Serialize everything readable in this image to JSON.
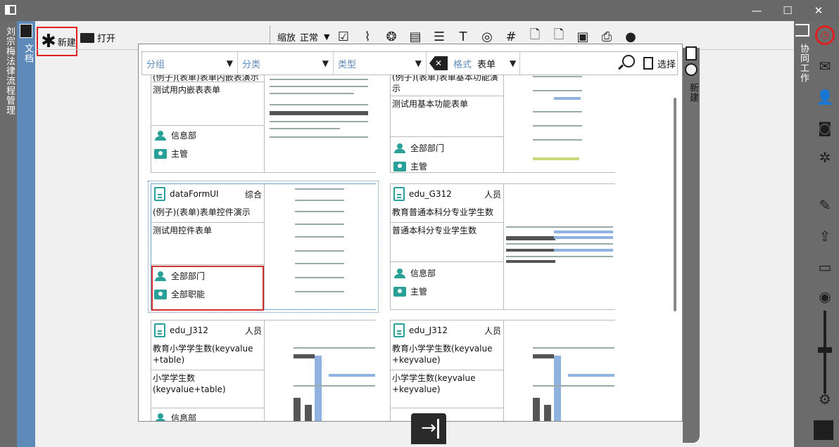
{
  "window": {
    "minimize": "—",
    "maximize": "☐",
    "close": "✕"
  },
  "left_strip": {
    "text": "刘宗梅法律流程管理"
  },
  "doc_strip": {
    "text": "文档"
  },
  "toolbar": {
    "new_label": "新建",
    "open_label": "打开",
    "zoom_label": "缩放",
    "zoom_value": "正常"
  },
  "new_strip": {
    "text": "新建"
  },
  "collab_strip": {
    "text": "协同工作"
  },
  "filter": {
    "group": "分组",
    "category": "分类",
    "type": "类型",
    "format_label": "格式",
    "format_value": "表单",
    "select": "选择"
  },
  "cards": [
    {
      "title": "(例子)(表单)表单内嵌表演示",
      "desc": "测试用内嵌表表单",
      "dept": "信息部",
      "role": "主管"
    },
    {
      "title": "(例子)(表单)表单基本功能演示",
      "desc": "测试用基本功能表单",
      "dept": "全部部门",
      "role": "主管"
    },
    {
      "code": "dataFormUI",
      "type": "综合",
      "title": "(例子)(表单)表单控件演示",
      "desc": "测试用控件表单",
      "dept": "全部部门",
      "role": "全部职能"
    },
    {
      "code": "edu_G312",
      "type": "人员",
      "title": "教育普通本科分专业学生数",
      "desc": "普通本科分专业学生数",
      "dept": "信息部",
      "role": "主管"
    },
    {
      "code": "edu_J312",
      "type": "人员",
      "title": "教育小学学生数(keyvalue +table)",
      "desc": "小学学生数(keyvalue+table)",
      "dept": "信息部"
    },
    {
      "code": "edu_J312",
      "type": "人员",
      "title": "教育小学学生数(keyvalue +keyvalue)",
      "desc": "小学学生数(keyvalue +keyvalue)"
    }
  ],
  "colors": {
    "accent": "#5d8ab8",
    "teal": "#2aa198",
    "highlight": "#e02020"
  }
}
